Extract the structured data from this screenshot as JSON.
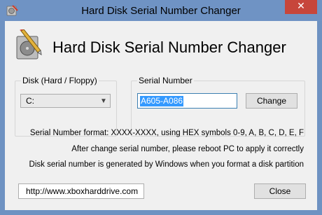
{
  "window": {
    "title": "Hard Disk Serial Number Changer",
    "close_glyph": "✕"
  },
  "header": {
    "title": "Hard Disk Serial Number Changer",
    "icon": "hard-disk-pencil-icon"
  },
  "disk_group": {
    "label": "Disk (Hard / Floppy)",
    "selected": "C:"
  },
  "serial_group": {
    "label": "Serial Number",
    "value": "A605-A086",
    "change_label": "Change"
  },
  "info": {
    "line1": "Serial Number format: XXXX-XXXX, using HEX symbols 0-9, A, B, C, D, E, F",
    "line2": "After change serial number, please reboot PC to apply it correctly",
    "line3": "Disk serial number is generated by Windows when you format a disk partition"
  },
  "footer": {
    "url": "http://www.xboxharddrive.com",
    "close_label": "Close"
  }
}
